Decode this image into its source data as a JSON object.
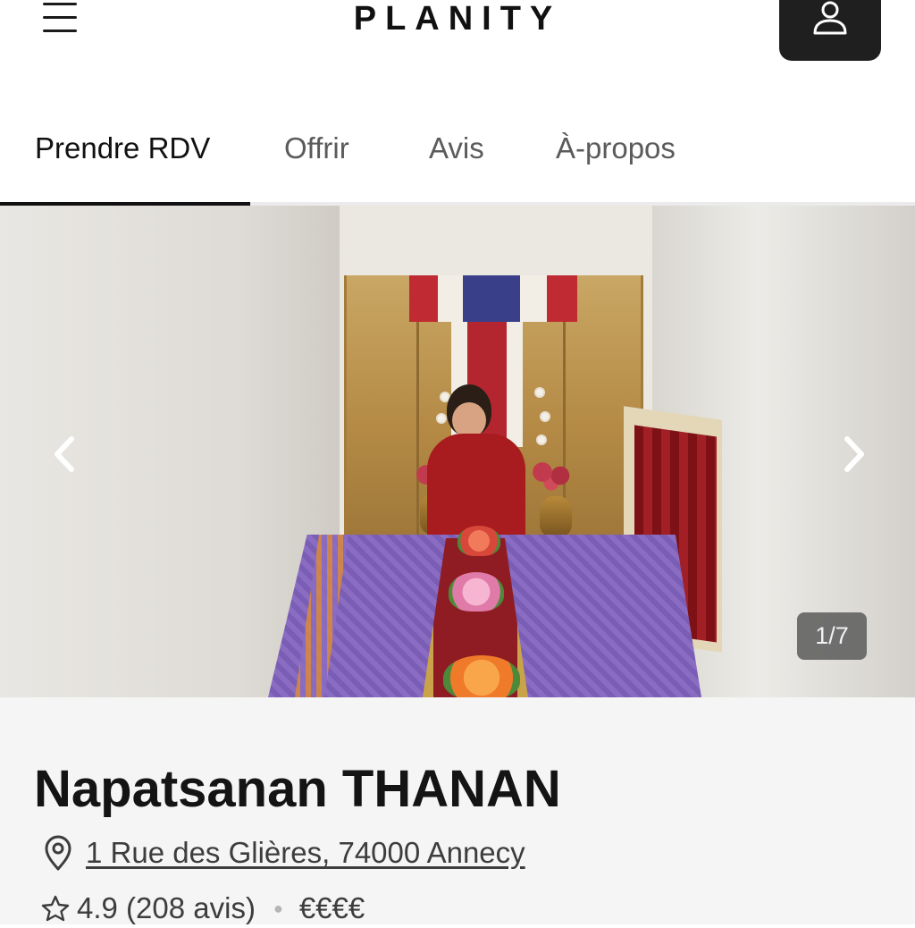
{
  "header": {
    "logo": "PLANITY",
    "menu_icon": "hamburger-menu-icon",
    "account_icon": "user-icon",
    "accent_color": "#1f1f1f"
  },
  "tabs": [
    {
      "label": "Prendre RDV",
      "active": true
    },
    {
      "label": "Offrir",
      "active": false
    },
    {
      "label": "Avis",
      "active": false
    },
    {
      "label": "À-propos",
      "active": false
    }
  ],
  "gallery": {
    "counter": "1/7",
    "prev_icon": "chevron-left-icon",
    "next_icon": "chevron-right-icon"
  },
  "salon": {
    "name": "Napatsanan THANAN",
    "address": "1 Rue des Glières, 74000 Annecy",
    "address_icon": "location-pin-icon",
    "rating_icon": "star-outline-icon",
    "rating": "4.9 (208 avis)",
    "price": "€€€€"
  }
}
